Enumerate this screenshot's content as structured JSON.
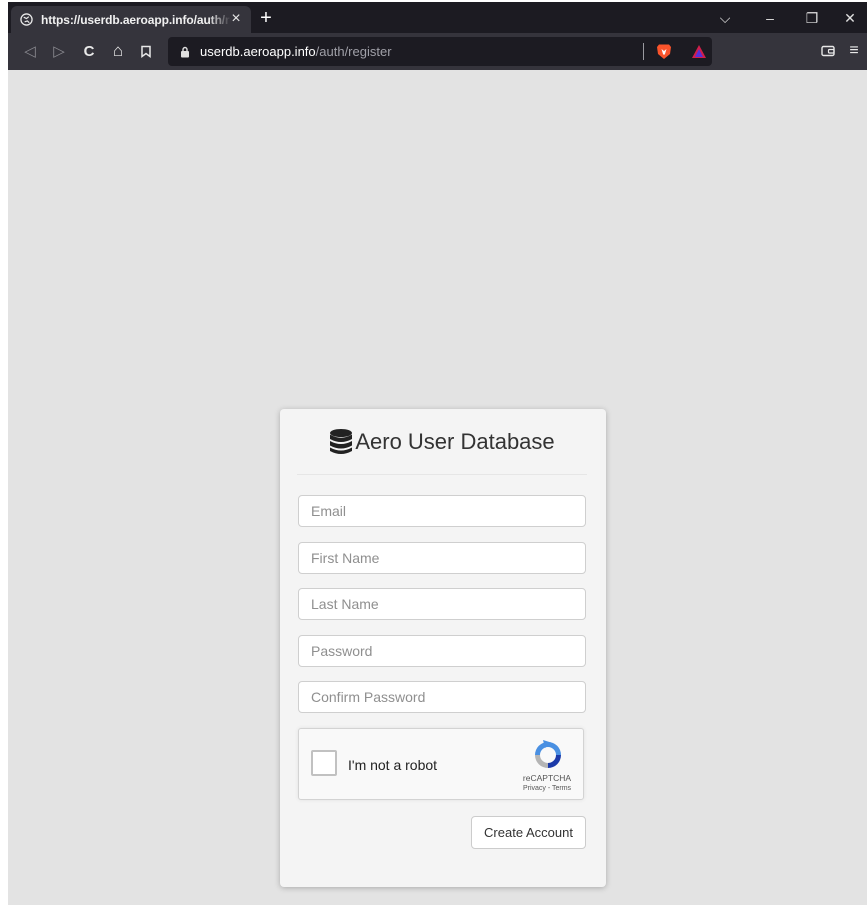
{
  "browser": {
    "tab": {
      "title": "https://userdb.aeroapp.info/auth/register",
      "favicon": "globe-icon",
      "close": "×"
    },
    "new_tab": "+",
    "window_controls": {
      "tab_list": "⌵",
      "minimize": "–",
      "restore": "❐",
      "close": "✕"
    },
    "nav": {
      "back": "◁",
      "forward": "▷",
      "reload": "C",
      "home": "⌂",
      "bookmark": "bookmark-icon"
    },
    "url": {
      "host": "userdb.aeroapp.info",
      "path": "/auth/register"
    },
    "right_icons": [
      "wallet-icon",
      "menu-icon"
    ],
    "menu_glyph": "≡"
  },
  "page": {
    "background": "#e3e3e3",
    "card": {
      "title": "Aero User Database",
      "icon": "database-icon",
      "fields": {
        "email": {
          "placeholder": "Email"
        },
        "first_name": {
          "placeholder": "First Name"
        },
        "last_name": {
          "placeholder": "Last Name"
        },
        "password": {
          "placeholder": "Password"
        },
        "confirm_password": {
          "placeholder": "Confirm Password"
        }
      },
      "captcha": {
        "label": "I'm not a robot",
        "brand": "reCAPTCHA",
        "links": "Privacy - Terms"
      },
      "submit_label": "Create Account"
    }
  }
}
